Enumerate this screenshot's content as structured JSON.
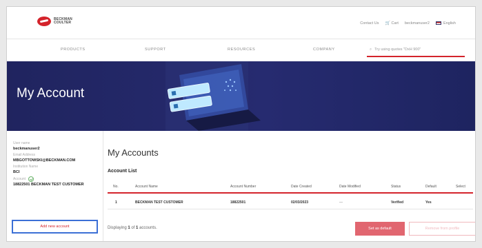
{
  "header": {
    "logo_text_line1": "BECKMAN",
    "logo_text_line2": "COULTER",
    "utility": {
      "contact": "Contact Us",
      "cart": "Cart",
      "username": "beckmanuser2",
      "language": "English"
    },
    "nav": [
      "PRODUCTS",
      "SUPPORT",
      "RESOURCES",
      "COMPANY"
    ],
    "search_placeholder": "Try using quotes \"DxH 900\""
  },
  "hero": {
    "title": "My Account"
  },
  "sidebar": {
    "username_label": "User name",
    "username": "beckmanuser2",
    "email_label": "Email Address",
    "email": "MBGOTTOWSKI@BECKMAN.COM",
    "institution_label": "Institution Name",
    "institution": "BCI",
    "account_label": "Account",
    "account_value": "18822501 BECKMAN TEST CUSTOMER",
    "add_button": "Add new account"
  },
  "main": {
    "title": "My Accounts",
    "list_title": "Account List",
    "columns": [
      "No.",
      "Account Name",
      "Account Number",
      "Date Created",
      "Date Modified",
      "Status",
      "Default",
      "Select"
    ],
    "rows": [
      {
        "no": "1",
        "name": "BECKMAN TEST CUSTOMER",
        "number": "18822501",
        "created": "02/03/2023",
        "modified": "—",
        "status": "Verified",
        "default": "Yes",
        "select": ""
      }
    ],
    "footer_prefix": "Displaying ",
    "footer_range": "1",
    "footer_mid": " of ",
    "footer_total": "1",
    "footer_suffix": " accounts.",
    "set_default_button": "Set as default",
    "remove_button": "Remove from profile"
  },
  "colors": {
    "brand_red": "#d4232b",
    "hero_navy": "#232866",
    "focus_blue": "#3b6fd6"
  }
}
